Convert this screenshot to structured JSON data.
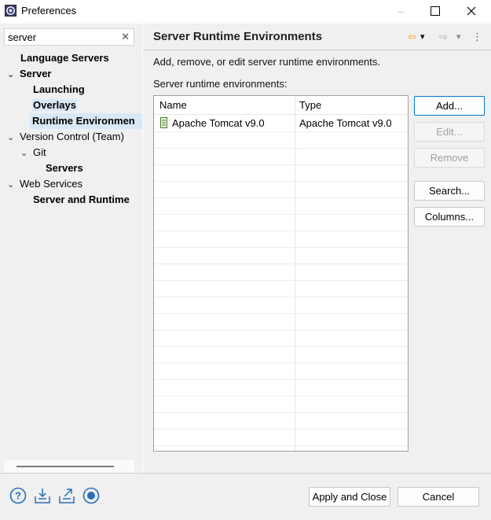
{
  "window": {
    "title": "Preferences",
    "minimize": "–",
    "maximize": "☐",
    "close": "✕"
  },
  "filter": {
    "value": "server",
    "clear_icon": "✕"
  },
  "tree": [
    {
      "label": "Language Servers",
      "bold": true
    },
    {
      "label": "Server",
      "bold": true,
      "expanded": true
    },
    {
      "label": "Launching",
      "bold": true
    },
    {
      "label": "Overlays",
      "bold": true
    },
    {
      "label": "Runtime Environmen",
      "bold": true,
      "selected": true
    },
    {
      "label": "Version Control (Team)",
      "expanded": true
    },
    {
      "label": "Git",
      "expanded": true
    },
    {
      "label": "Servers",
      "bold": true
    },
    {
      "label": "Web Services",
      "expanded": true
    },
    {
      "label": "Server and Runtime",
      "bold": true
    }
  ],
  "tree_chevron": "⌄",
  "page": {
    "title": "Server Runtime Environments",
    "description": "Add, remove, or edit server runtime environments.",
    "list_label": "Server runtime environments:"
  },
  "nav": {
    "back": "⇦",
    "back_menu": "▾",
    "forward": "⇨",
    "forward_menu": "▾",
    "more": "⋮"
  },
  "table": {
    "columns": [
      "Name",
      "Type"
    ],
    "rows": [
      {
        "name": "Apache Tomcat v9.0",
        "type": "Apache Tomcat v9.0"
      }
    ]
  },
  "buttons": {
    "add": "Add...",
    "edit": "Edit...",
    "remove": "Remove",
    "search": "Search...",
    "columns": "Columns..."
  },
  "footer": {
    "apply_close": "Apply and Close",
    "cancel": "Cancel"
  },
  "colors": {
    "accent": "#0078d4",
    "selection": "#d9e8f7",
    "nav_back": "#e8a317",
    "icon_blue": "#2a6ebb"
  }
}
